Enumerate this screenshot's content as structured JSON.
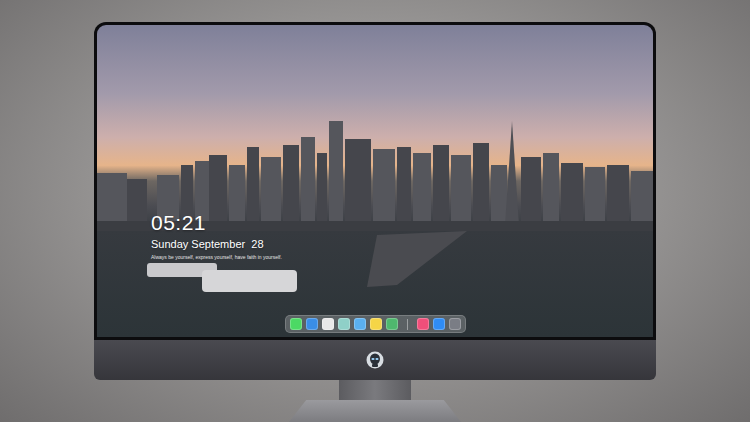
{
  "lock_screen": {
    "time": "05:21",
    "date": "Sunday September  28",
    "quote": "Always be yourself, express yourself, have faith in yourself."
  },
  "dock": {
    "apps": [
      {
        "color": "#4cd964"
      },
      {
        "color": "#3a8ee6"
      },
      {
        "color": "#e8e8e8"
      },
      {
        "color": "#8fd0c8"
      },
      {
        "color": "#5ab0f0"
      },
      {
        "color": "#f5d547"
      },
      {
        "color": "#4fb86e"
      }
    ],
    "others": [
      {
        "color": "#f04f7a"
      },
      {
        "color": "#2f8cf5"
      },
      {
        "color": "#7a7d85"
      }
    ]
  }
}
